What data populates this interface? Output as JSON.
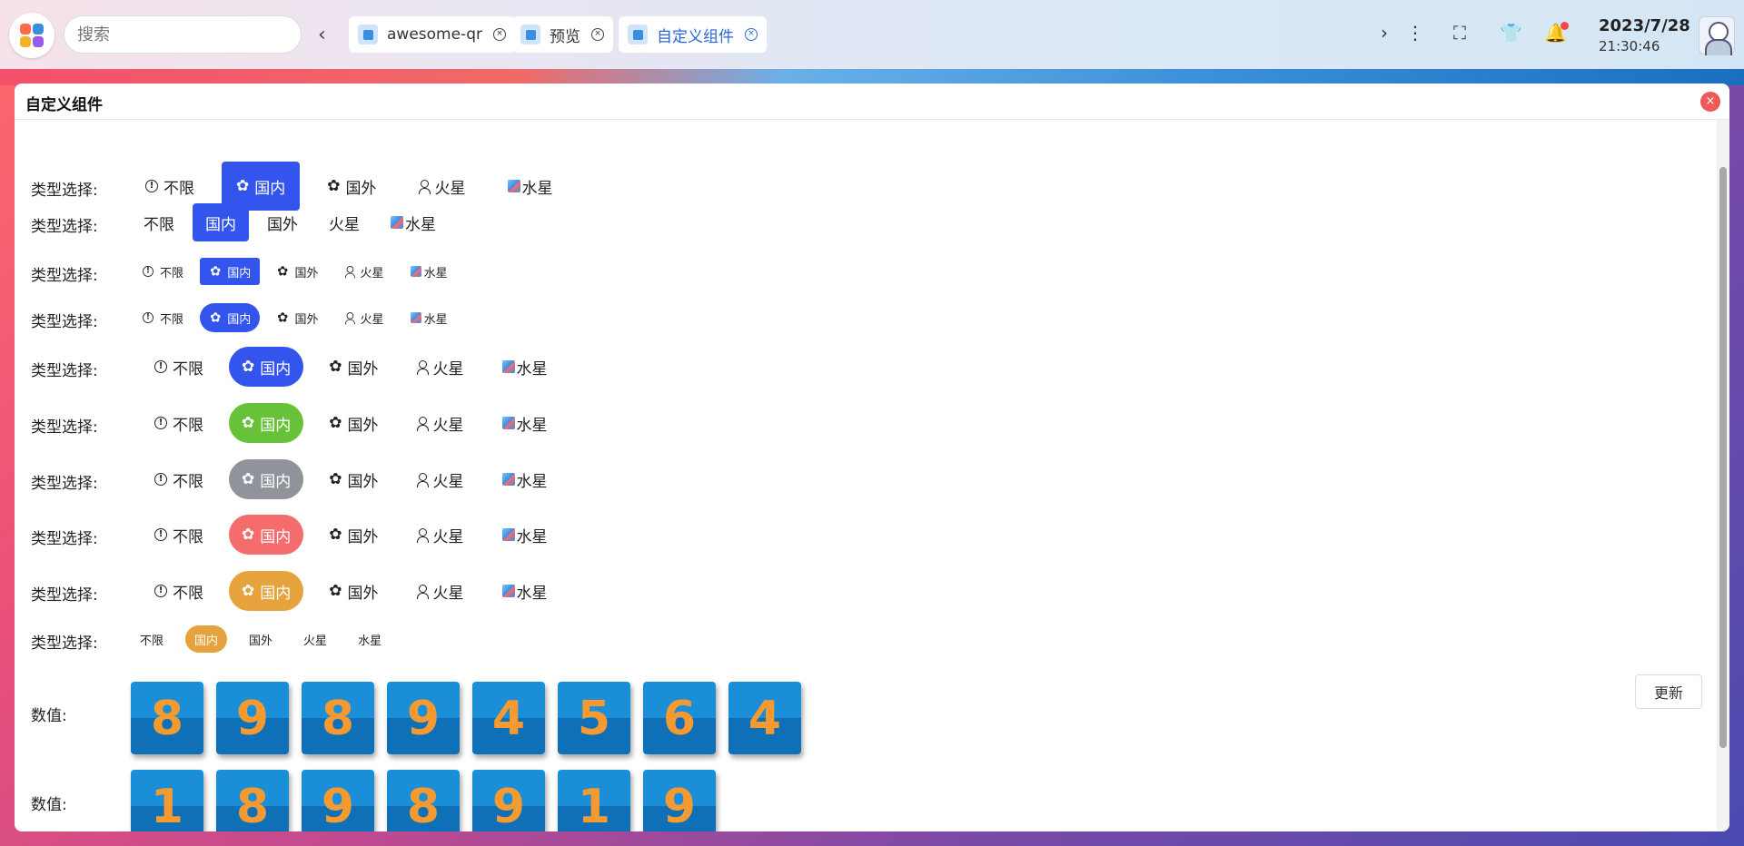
{
  "topbar": {
    "search_placeholder": "搜索",
    "tabs": [
      {
        "label": "awesome-qr"
      },
      {
        "label": "预览"
      },
      {
        "label": "自定义组件"
      }
    ],
    "date": "2023/7/28",
    "time": "21:30:46"
  },
  "window": {
    "title": "自定义组件"
  },
  "rows": [
    {
      "label": "类型选择:",
      "options": [
        "不限",
        "国内",
        "国外",
        "火星",
        "水星"
      ],
      "selected": 1
    },
    {
      "label": "类型选择:",
      "options": [
        "不限",
        "国内",
        "国外",
        "火星",
        "水星"
      ],
      "selected": 1
    },
    {
      "label": "类型选择:",
      "options": [
        "不限",
        "国内",
        "国外",
        "火星",
        "水星"
      ],
      "selected": 1
    },
    {
      "label": "类型选择:",
      "options": [
        "不限",
        "国内",
        "国外",
        "火星",
        "水星"
      ],
      "selected": 1
    },
    {
      "label": "类型选择:",
      "options": [
        "不限",
        "国内",
        "国外",
        "火星",
        "水星"
      ],
      "selected": 1
    },
    {
      "label": "类型选择:",
      "options": [
        "不限",
        "国内",
        "国外",
        "火星",
        "水星"
      ],
      "selected": 1
    },
    {
      "label": "类型选择:",
      "options": [
        "不限",
        "国内",
        "国外",
        "火星",
        "水星"
      ],
      "selected": 1
    },
    {
      "label": "类型选择:",
      "options": [
        "不限",
        "国内",
        "国外",
        "火星",
        "水星"
      ],
      "selected": 1
    },
    {
      "label": "类型选择:",
      "options": [
        "不限",
        "国内",
        "国外",
        "火星",
        "水星"
      ],
      "selected": 1
    },
    {
      "label": "类型选择:",
      "options": [
        "不限",
        "国内",
        "国外",
        "火星",
        "水星"
      ],
      "selected": 1
    }
  ],
  "colors": {
    "primary": "#3355ee",
    "success": "#67c23a",
    "info": "#909399",
    "danger": "#f56c6c",
    "warning": "#e6a23c",
    "digit_text": "#f59a30",
    "digit_bg": "#1a8fd8"
  },
  "icons": {
    "opt0": "info-icon",
    "opt1": "gear-icon",
    "opt2": "gear-icon",
    "opt3": "user-icon",
    "opt4": "cube-icon"
  },
  "values": [
    {
      "label": "数值:",
      "digits": [
        "8",
        "9",
        "8",
        "9",
        "4",
        "5",
        "6",
        "4"
      ]
    },
    {
      "label": "数值:",
      "digits": [
        "1",
        "8",
        "9",
        "8",
        "9",
        "1",
        "9"
      ]
    }
  ],
  "update_label": "更新"
}
